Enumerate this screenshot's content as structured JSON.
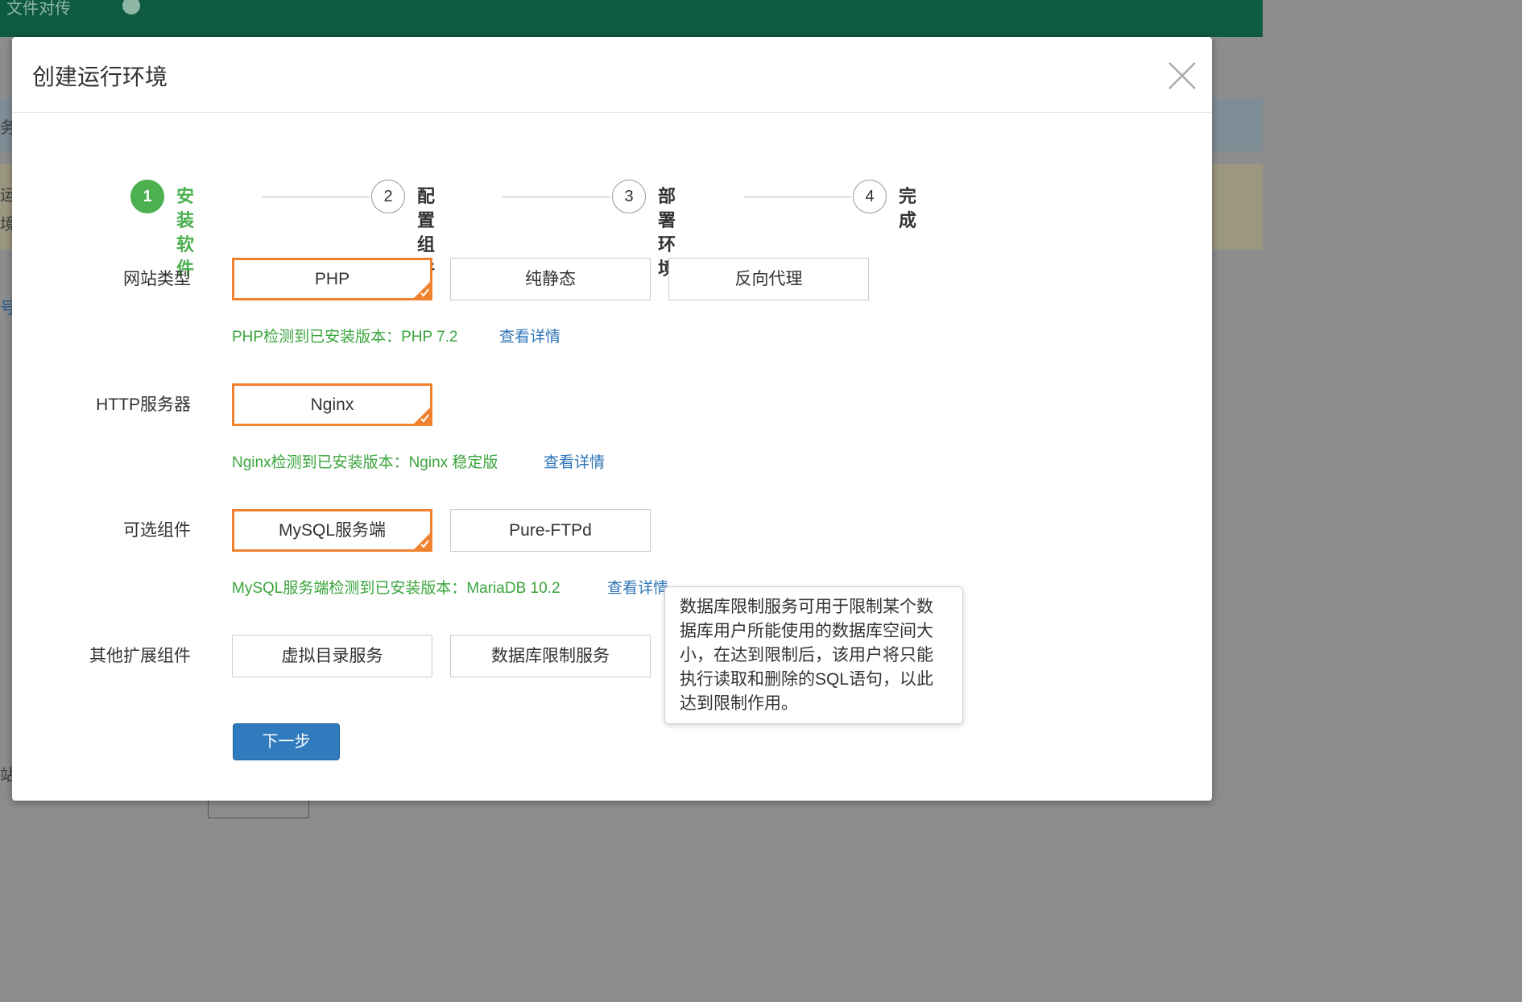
{
  "background": {
    "topbar_title": "文件对传",
    "edge_texts": [
      "务",
      "运",
      "境",
      "号",
      "站"
    ]
  },
  "modal": {
    "title": "创建运行环境"
  },
  "steps": [
    {
      "number": "1",
      "label": "安装软件",
      "active": true
    },
    {
      "number": "2",
      "label": "配置组件",
      "active": false
    },
    {
      "number": "3",
      "label": "部署环境",
      "active": false
    },
    {
      "number": "4",
      "label": "完成",
      "active": false
    }
  ],
  "rows": {
    "site_type": {
      "label": "网站类型",
      "options": [
        "PHP",
        "纯静态",
        "反向代理"
      ],
      "selected": "PHP",
      "note": "PHP检测到已安装版本：PHP 7.2",
      "link": "查看详情"
    },
    "http_server": {
      "label": "HTTP服务器",
      "options": [
        "Nginx"
      ],
      "selected": "Nginx",
      "note": "Nginx检测到已安装版本：Nginx 稳定版",
      "link": "查看详情"
    },
    "optional": {
      "label": "可选组件",
      "options": [
        "MySQL服务端",
        "Pure-FTPd"
      ],
      "selected": "MySQL服务端",
      "note": "MySQL服务端检测到已安装版本：MariaDB 10.2",
      "link": "查看详情"
    },
    "extensions": {
      "label": "其他扩展组件",
      "options": [
        "虚拟目录服务",
        "数据库限制服务"
      ]
    }
  },
  "next_button": "下一步",
  "tooltip": {
    "text": "数据库限制服务可用于限制某个数据库用户所能使用的数据库空间大小，在达到限制后，该用户将只能执行读取和删除的SQL语句，以此达到限制作用。"
  },
  "colors": {
    "accent_green": "#4cb050",
    "selected_orange": "#f0822f",
    "link_blue": "#2d74b5",
    "primary_button": "#2f7bbd",
    "topbar": "#0f5b42"
  }
}
